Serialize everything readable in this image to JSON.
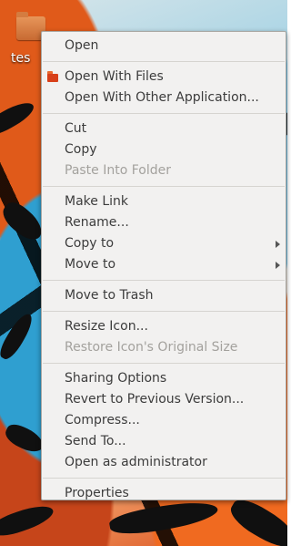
{
  "desktop": {
    "icon_label": "tes",
    "icon": "folder-icon"
  },
  "menu": {
    "items": [
      {
        "label": "Open",
        "disabled": false
      },
      {
        "label": "Open With Files",
        "disabled": false,
        "icon": "files-app-icon"
      },
      {
        "label": "Open With Other Application...",
        "disabled": false
      },
      {
        "label": "Cut",
        "disabled": false
      },
      {
        "label": "Copy",
        "disabled": false
      },
      {
        "label": "Paste Into Folder",
        "disabled": true
      },
      {
        "label": "Make Link",
        "disabled": false
      },
      {
        "label": "Rename...",
        "disabled": false
      },
      {
        "label": "Copy to",
        "disabled": false,
        "submenu": true
      },
      {
        "label": "Move to",
        "disabled": false,
        "submenu": true
      },
      {
        "label": "Move to Trash",
        "disabled": false
      },
      {
        "label": "Resize Icon...",
        "disabled": false
      },
      {
        "label": "Restore Icon's Original Size",
        "disabled": true
      },
      {
        "label": "Sharing Options",
        "disabled": false
      },
      {
        "label": "Revert to Previous Version...",
        "disabled": false
      },
      {
        "label": "Compress...",
        "disabled": false
      },
      {
        "label": "Send To...",
        "disabled": false
      },
      {
        "label": "Open as administrator",
        "disabled": false
      },
      {
        "label": "Properties",
        "disabled": false
      }
    ]
  }
}
